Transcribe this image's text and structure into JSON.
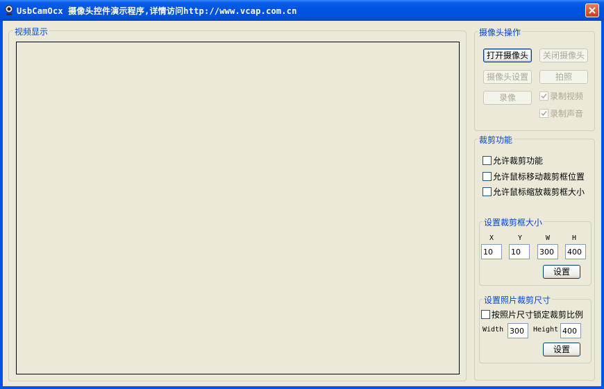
{
  "window": {
    "title": "UsbCamOcx 摄像头控件演示程序,详情访问http://www.vcap.com.cn"
  },
  "video": {
    "legend": "视频显示"
  },
  "camera": {
    "legend": "摄像头操作",
    "open_label": "打开摄像头",
    "close_label": "关闭摄像头",
    "settings_label": "摄像头设置",
    "snapshot_label": "拍照",
    "record_label": "录像",
    "record_video_label": "录制视频",
    "record_audio_label": "录制声音"
  },
  "crop": {
    "legend": "裁剪功能",
    "allow_crop_label": "允许裁剪功能",
    "allow_move_label": "允许鼠标移动裁剪框位置",
    "allow_resize_label": "允许鼠标缩放裁剪框大小",
    "box": {
      "legend": "设置裁剪框大小",
      "x_label": "X",
      "y_label": "Y",
      "w_label": "W",
      "h_label": "H",
      "x_value": "10",
      "y_value": "10",
      "w_value": "300",
      "h_value": "400",
      "set_label": "设置"
    },
    "photo": {
      "legend": "设置照片裁剪尺寸",
      "lock_label": "按照片尺寸锁定裁剪比例",
      "width_label": "Width",
      "width_value": "300",
      "height_label": "Height",
      "height_value": "400",
      "set_label": "设置"
    }
  }
}
